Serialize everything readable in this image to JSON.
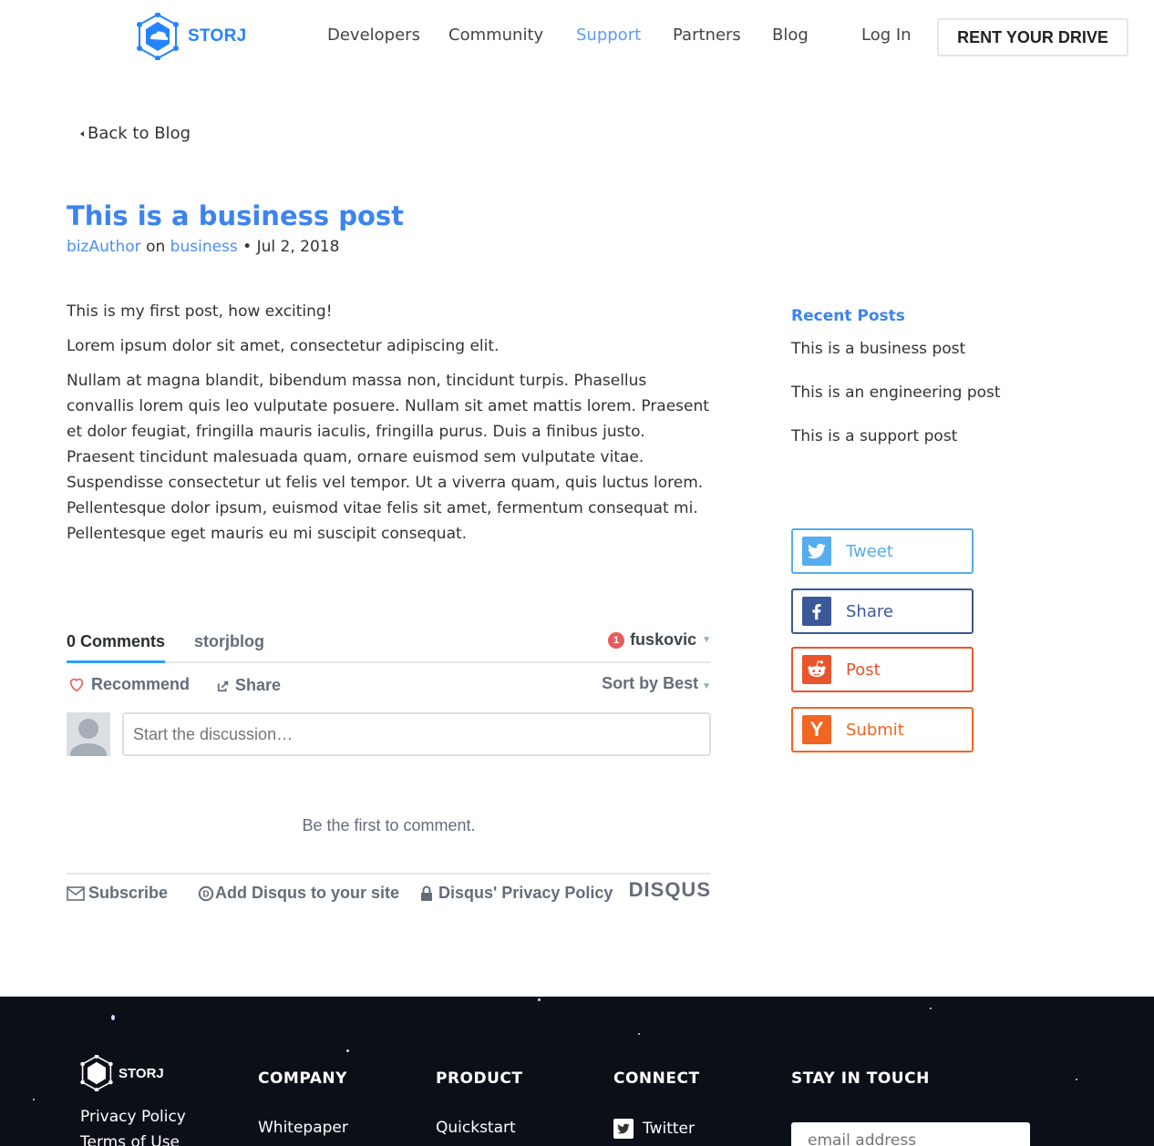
{
  "header": {
    "logo_text": "STORJ",
    "nav": [
      "Developers",
      "Community",
      "Support",
      "Partners",
      "Blog"
    ],
    "login": "Log In",
    "cta": "RENT YOUR DRIVE"
  },
  "back_link": "Back to Blog",
  "post": {
    "title": "This is a business post",
    "author": "bizAuthor",
    "on": "on",
    "category": "business",
    "date": "• Jul 2, 2018",
    "paragraphs": [
      "This is my first post, how exciting!",
      "Lorem ipsum dolor sit amet, consectetur adipiscing elit.",
      "Nullam at magna blandit, bibendum massa non, tincidunt turpis. Phasellus convallis lorem quis leo vulputate posuere. Nullam sit amet mattis lorem. Praesent et dolor feugiat, fringilla mauris iaculis, fringilla purus. Duis a finibus justo. Praesent tincidunt malesuada quam, ornare euismod sem vulputate vitae. Suspendisse consectetur ut felis vel tempor. Ut a viverra quam, quis luctus lorem. Pellentesque dolor ipsum, euismod vitae felis sit amet, fermentum consequat mi. Pellentesque eget mauris eu mi suscipit consequat."
    ]
  },
  "sidebar": {
    "recent_title": "Recent Posts",
    "recent": [
      "This is a business post",
      "This is an engineering post",
      "This is a support post"
    ],
    "share": {
      "tweet": "Tweet",
      "facebook": "Share",
      "reddit": "Post",
      "hn": "Submit"
    },
    "colors": {
      "twitter": "#55acee",
      "facebook": "#3b5998",
      "reddit": "#ff4500",
      "hn": "#ff6600"
    }
  },
  "disqus": {
    "comments_tab": "0 Comments",
    "forum_tab": "storjblog",
    "user": "fuskovic",
    "notif_count": "1",
    "recommend": "Recommend",
    "share": "Share",
    "sort": "Sort by Best",
    "placeholder": "Start the discussion…",
    "empty": "Be the first to comment.",
    "subscribe": "Subscribe",
    "add_disqus": "Add Disqus to your site",
    "privacy": "Disqus' Privacy Policy",
    "brand": "DISQUS"
  },
  "footer": {
    "logo_text": "STORJ",
    "privacy": "Privacy Policy",
    "terms": "Terms of Use",
    "company_head": "COMPANY",
    "company_link": "Whitepaper",
    "product_head": "PRODUCT",
    "product_link": "Quickstart",
    "connect_head": "CONNECT",
    "connect_link": "Twitter",
    "stay_head": "STAY IN TOUCH",
    "email_placeholder": "email address"
  }
}
